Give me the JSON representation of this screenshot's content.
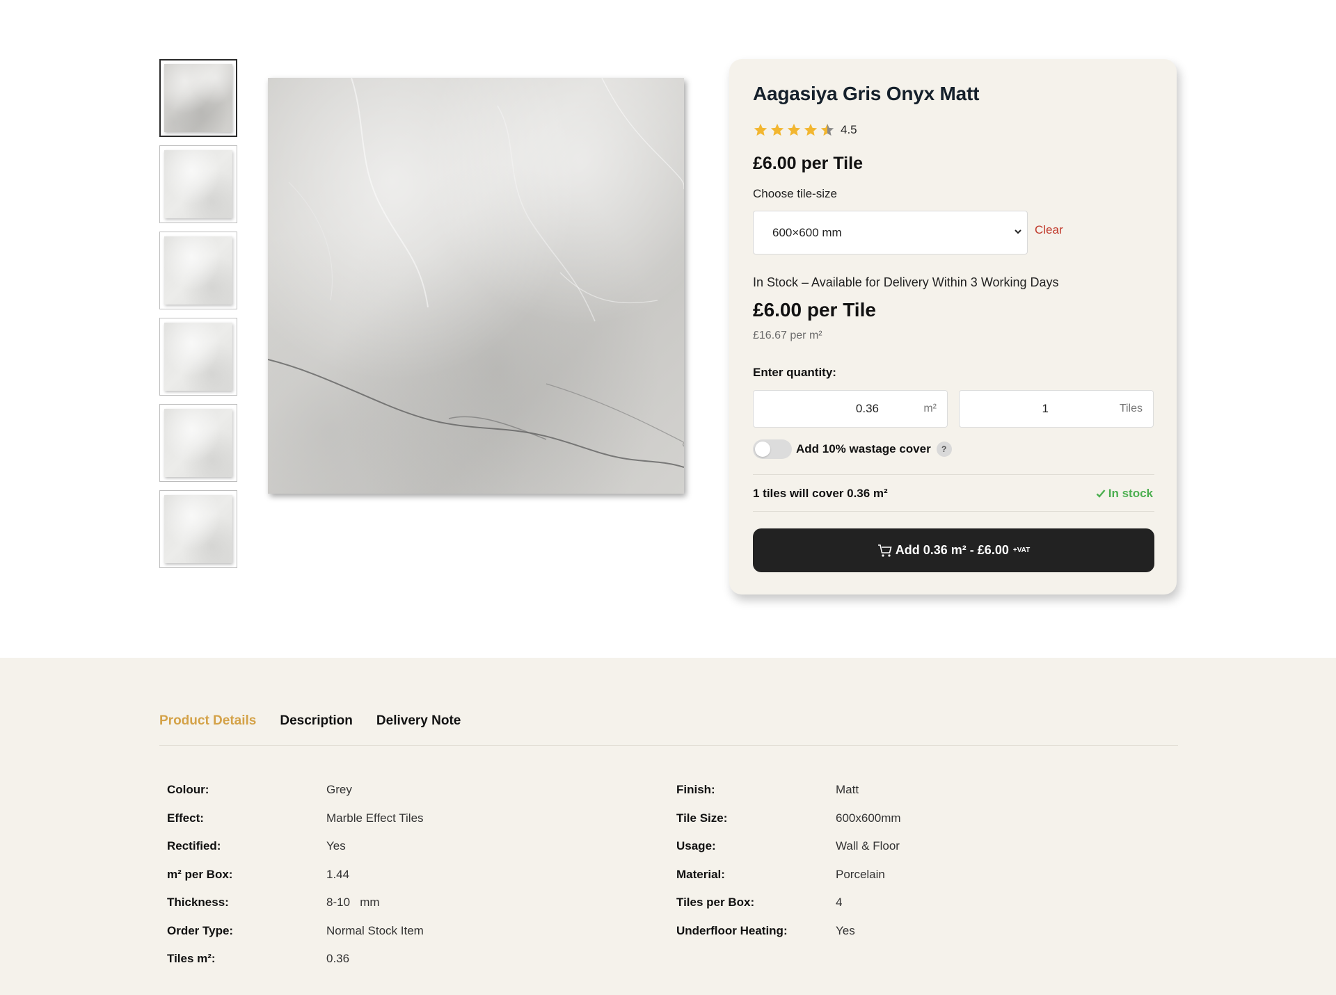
{
  "gallery": {
    "thumbnails": [
      "thumb-1",
      "thumb-2",
      "thumb-3",
      "thumb-4",
      "thumb-5",
      "thumb-6"
    ],
    "main_image": "marble-tile-image"
  },
  "product": {
    "title": "Aagasiya Gris Onyx Matt",
    "rating": 4.5,
    "rating_label": "4.5",
    "price_label": "£6.00 per Tile",
    "size_label": "Choose tile-size",
    "size_selected": "600×600 mm",
    "clear_label": "Clear",
    "stock_message": "In Stock – Available for Delivery Within 3 Working Days",
    "price_big": "£6.00 per Tile",
    "price_per_m2": "£16.67 per m²",
    "quantity_label": "Enter quantity:",
    "qty_m2": "0.36",
    "qty_m2_unit": "m²",
    "qty_tiles": "1",
    "qty_tiles_unit": "Tiles",
    "wastage_label": "Add 10% wastage cover",
    "wastage_help": "?",
    "wastage_enabled": false,
    "cover_text": "1 tiles will cover 0.36 m²",
    "instock_text": "In stock",
    "add_button_label": "Add 0.36 m² - £6.00",
    "add_button_vat": "+VAT",
    "star_color": "#f2b630",
    "accent_green": "#4caf50",
    "clear_color": "#c0392b"
  },
  "details": {
    "tabs": [
      {
        "label": "Product Details",
        "active": true
      },
      {
        "label": "Description",
        "active": false
      },
      {
        "label": "Delivery Note",
        "active": false
      }
    ],
    "left_specs": [
      {
        "key": "Colour:",
        "value": "Grey"
      },
      {
        "key": "Effect:",
        "value": "Marble Effect Tiles"
      },
      {
        "key": "Rectified:",
        "value": "Yes"
      },
      {
        "key": "m² per Box:",
        "value": "1.44"
      },
      {
        "key": "Thickness:",
        "value": "8-10   mm"
      },
      {
        "key": "Order Type:",
        "value": "Normal Stock Item"
      },
      {
        "key": "Tiles m²:",
        "value": "0.36"
      }
    ],
    "right_specs": [
      {
        "key": "Finish:",
        "value": "Matt"
      },
      {
        "key": "Tile Size:",
        "value": "600x600mm"
      },
      {
        "key": "Usage:",
        "value": "Wall & Floor"
      },
      {
        "key": "Material:",
        "value": "Porcelain"
      },
      {
        "key": "Tiles per Box:",
        "value": "4"
      },
      {
        "key": "Underfloor Heating:",
        "value": "Yes"
      }
    ],
    "active_tab_color": "#d4a248"
  }
}
